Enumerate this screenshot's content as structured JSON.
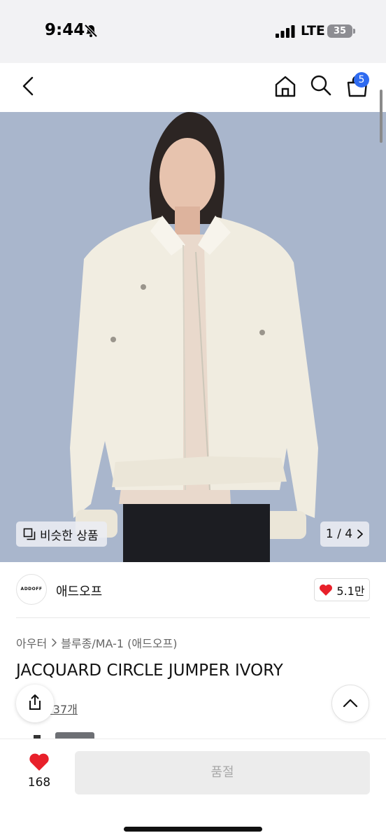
{
  "status_bar": {
    "time": "9:44",
    "network": "LTE",
    "battery": "35",
    "icons": [
      "bell-off-icon",
      "signal-icon",
      "battery-icon"
    ]
  },
  "nav": {
    "icons": [
      "back-icon",
      "home-icon",
      "search-icon",
      "cart-icon"
    ],
    "cart_badge": "5",
    "badge_color": "#2f6bf0"
  },
  "hero": {
    "similar_label": "비슷한 상품",
    "pager": "1 / 4",
    "icons": [
      "similar-icon",
      "chevron-right-icon"
    ],
    "background_color": "#a9b6cc"
  },
  "brand": {
    "logo_text": "ADDOFF",
    "name": "애드오프",
    "like_count": "5.1만",
    "accent_color": "#e8202a"
  },
  "breadcrumb": {
    "items": [
      "아우터",
      "블루종/MA-1 (애드오프)"
    ]
  },
  "product": {
    "title": "JACQUARD CIRCLE JUMPER IVORY",
    "review_link": "기 37개"
  },
  "bottom_bar": {
    "wish_count": "168",
    "cta_label": "품절",
    "icons": [
      "share-icon",
      "chevron-up-icon",
      "heart-icon"
    ]
  }
}
